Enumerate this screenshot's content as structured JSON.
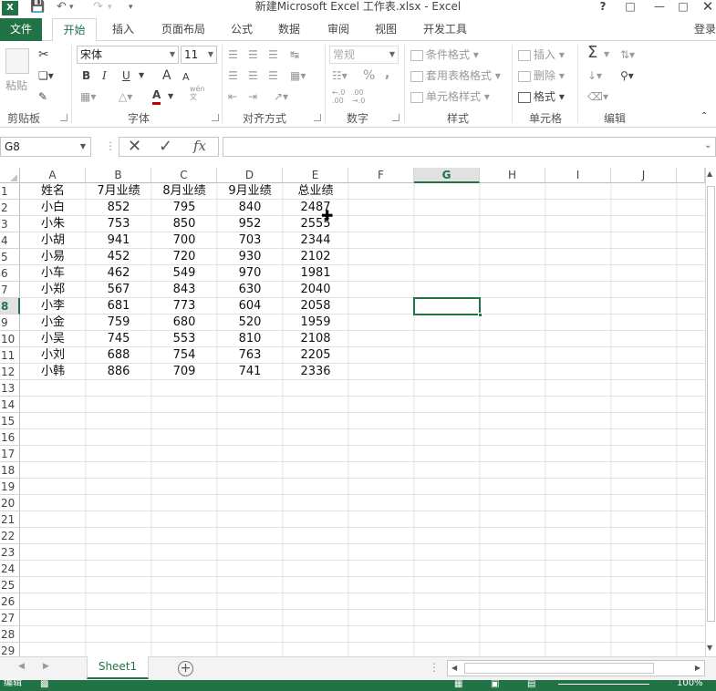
{
  "window": {
    "title": "新建Microsoft Excel 工作表.xlsx - Excel",
    "help": "?",
    "logo": "XE"
  },
  "ribbon_tabs": [
    "文件",
    "开始",
    "插入",
    "页面布局",
    "公式",
    "数据",
    "审阅",
    "视图",
    "开发工具"
  ],
  "login": "登录",
  "ribbon": {
    "clipboard": {
      "paste": "粘贴",
      "label": "剪贴板"
    },
    "font": {
      "name": "宋体",
      "size": "11",
      "bold": "B",
      "italic": "I",
      "underline": "U",
      "grow": "A",
      "shrink": "A",
      "color_letter": "A",
      "wen": "wén",
      "wen2": "文",
      "label": "字体"
    },
    "alignment": {
      "label": "对齐方式"
    },
    "number": {
      "format": "常规",
      "percent": "%",
      "comma": ",",
      "label": "数字"
    },
    "styles": {
      "conditional": "条件格式",
      "table": "套用表格格式",
      "cell_styles": "单元格样式",
      "label": "样式"
    },
    "cells": {
      "insert": "插入",
      "delete": "删除",
      "format": "格式",
      "label": "单元格"
    },
    "editing": {
      "label": "编辑"
    }
  },
  "formula_bar": {
    "name_box": "G8",
    "fx": "fx",
    "value": ""
  },
  "columns": [
    "A",
    "B",
    "C",
    "D",
    "E",
    "F",
    "G",
    "H",
    "I",
    "J"
  ],
  "selected_column": "G",
  "selected_row": "8",
  "rows": [
    [
      "姓名",
      "7月业绩",
      "8月业绩",
      "9月业绩",
      "总业绩"
    ],
    [
      "小白",
      "852",
      "795",
      "840",
      "2487"
    ],
    [
      "小朱",
      "753",
      "850",
      "952",
      "2555"
    ],
    [
      "小胡",
      "941",
      "700",
      "703",
      "2344"
    ],
    [
      "小易",
      "452",
      "720",
      "930",
      "2102"
    ],
    [
      "小车",
      "462",
      "549",
      "970",
      "1981"
    ],
    [
      "小郑",
      "567",
      "843",
      "630",
      "2040"
    ],
    [
      "小李",
      "681",
      "773",
      "604",
      "2058"
    ],
    [
      "小金",
      "759",
      "680",
      "520",
      "1959"
    ],
    [
      "小吴",
      "745",
      "553",
      "810",
      "2108"
    ],
    [
      "小刘",
      "688",
      "754",
      "763",
      "2205"
    ],
    [
      "小韩",
      "886",
      "709",
      "741",
      "2336"
    ]
  ],
  "row_numbers": [
    "1",
    "2",
    "3",
    "4",
    "5",
    "6",
    "7",
    "8",
    "9",
    "10",
    "11",
    "12",
    "13",
    "14",
    "15",
    "16",
    "17",
    "18",
    "19",
    "20",
    "21",
    "22",
    "23",
    "24",
    "25",
    "26",
    "27",
    "28",
    "29"
  ],
  "sheet_tabs": [
    "Sheet1"
  ],
  "status": {
    "mode": "编辑",
    "zoom": "100%"
  },
  "colors": {
    "accent": "#217346"
  }
}
